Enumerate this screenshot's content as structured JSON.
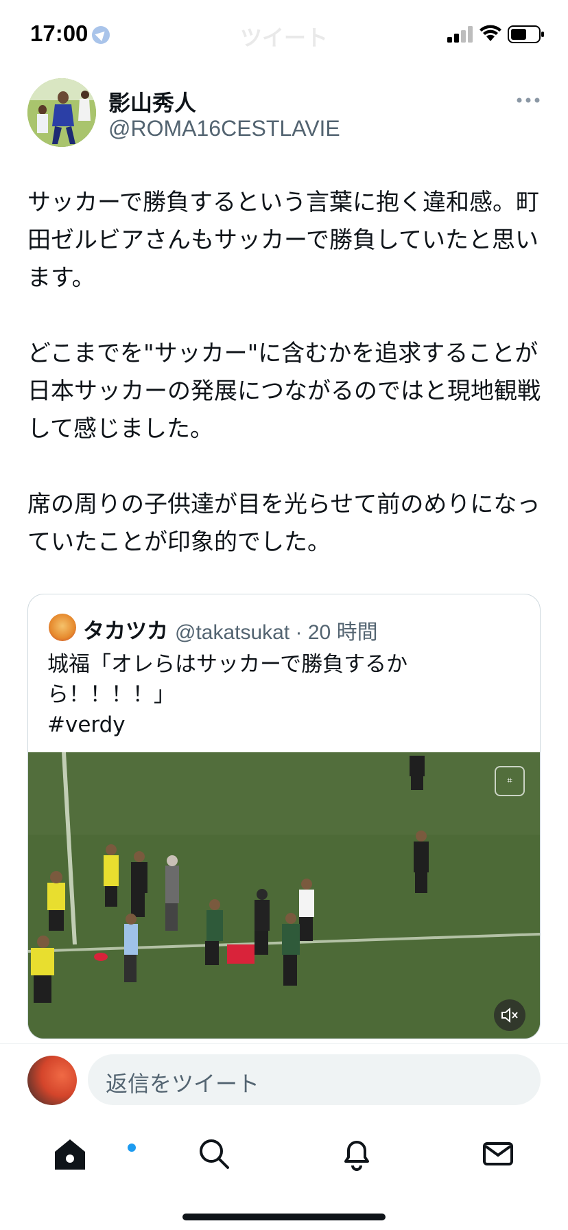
{
  "status_bar": {
    "time": "17:00",
    "title": "ツイート",
    "icons": [
      "location-arrow-icon",
      "cellular-signal-icon",
      "wifi-icon",
      "battery-icon"
    ]
  },
  "tweet": {
    "author": {
      "display_name": "影山秀人",
      "handle": "@ROMA16CESTLAVIE"
    },
    "paragraphs": [
      "サッカーで勝負するという言葉に抱く違和感。町田ゼルビアさんもサッカーで勝負していたと思います。",
      "どこまでを\"サッカー\"に含むかを追求することが日本サッカーの発展につながるのではと現地観戦して感じました。",
      "席の周りの子供達が目を光らせて前のめりになっていたことが印象的でした。"
    ]
  },
  "quote": {
    "author": {
      "display_name": "タカツカ",
      "handle": "@takatsukat",
      "time": "· 20 時間"
    },
    "text_line1": "城福「オレらはサッカーで勝負するか",
    "text_line2": "ら！！！！」",
    "hashtag": "#verdy",
    "media": {
      "type": "video",
      "muted": true
    }
  },
  "reply": {
    "placeholder": "返信をツイート"
  },
  "tab_bar": {
    "items": [
      "home-icon",
      "search-icon",
      "notifications-icon",
      "messages-icon"
    ],
    "active": "home-icon",
    "home_badge_color": "#1d9bf0"
  },
  "colors": {
    "accent": "#1d9bf0",
    "text_primary": "#0f1419",
    "text_secondary": "#536471"
  }
}
